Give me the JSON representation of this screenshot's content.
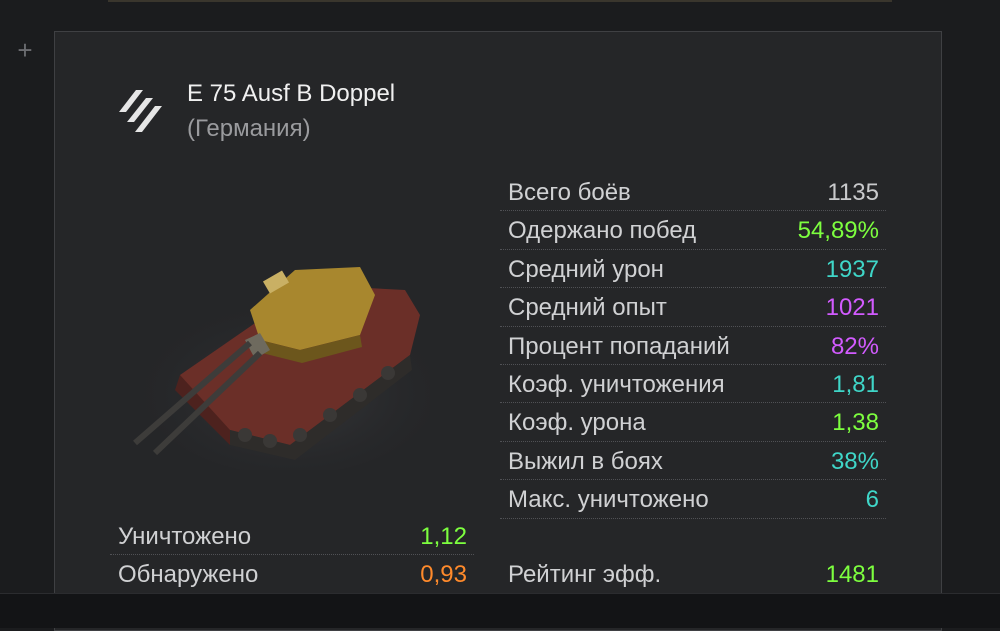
{
  "tank": {
    "name": "E 75 Ausf B Doppel",
    "nation": "(Германия)",
    "class_icon": "heavy-tank-class-icon"
  },
  "stats_right": [
    {
      "label": "Всего боёв",
      "value": "1135",
      "color": "#c9cacc"
    },
    {
      "label": "Одержано побед",
      "value": "54,89%",
      "color": "#7dff3f"
    },
    {
      "label": "Средний урон",
      "value": "1937",
      "color": "#3fd6c8"
    },
    {
      "label": "Средний опыт",
      "value": "1021",
      "color": "#d25bff"
    },
    {
      "label": "Процент попаданий",
      "value": "82%",
      "color": "#d25bff"
    },
    {
      "label": "Коэф. уничтожения",
      "value": "1,81",
      "color": "#3fd6c8"
    },
    {
      "label": "Коэф. урона",
      "value": "1,38",
      "color": "#7dff3f"
    },
    {
      "label": "Выжил в боях",
      "value": "38%",
      "color": "#3fd6c8"
    },
    {
      "label": "Макс. уничтожено",
      "value": "6",
      "color": "#3fd6c8"
    }
  ],
  "stats_left": [
    {
      "label": "Уничтожено",
      "value": "1,12",
      "color": "#7dff3f"
    },
    {
      "label": "Обнаружено",
      "value": "0,93",
      "color": "#ff8a2b"
    }
  ],
  "rating": {
    "label": "Рейтинг эфф.",
    "value": "1481",
    "color": "#7dff3f"
  }
}
